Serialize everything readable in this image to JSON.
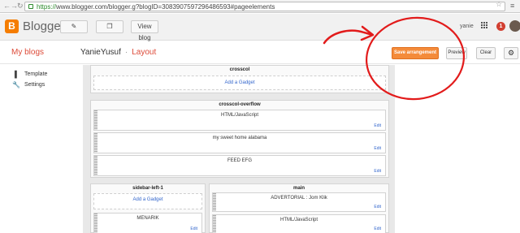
{
  "browser": {
    "url_scheme": "https://",
    "url_rest": "www.blogger.com/blogger.g?blogID=3083907597296486593#pageelements"
  },
  "topbar": {
    "logo_letter": "B",
    "logo_text": "Blogger",
    "view_blog_label": "View blog",
    "user_name": "yanie",
    "notification_count": "1"
  },
  "header": {
    "my_blogs": "My blogs",
    "blog_name": "YanieYusuf",
    "separator": "·",
    "section": "Layout",
    "save_label": "Save arrangement",
    "preview_label": "Preview",
    "clear_label": "Clear"
  },
  "sidebar": {
    "items": [
      {
        "label": "Template",
        "icon": "template-icon"
      },
      {
        "label": "Settings",
        "icon": "settings-wrench-icon"
      }
    ]
  },
  "layout": {
    "add_gadget_label": "Add a Gadget",
    "edit_label": "Edit",
    "crosscol": {
      "title": "crosscol"
    },
    "crosscol_overflow": {
      "title": "crosscol-overflow",
      "widgets": [
        "HTML/JavaScript",
        "my sweet home alabama",
        "FEED EFG"
      ]
    },
    "sidebar_left": {
      "title": "sidebar-left-1",
      "widgets": [
        "MENARIK"
      ]
    },
    "main": {
      "title": "main",
      "widgets": [
        "ADVERTORIAL : Jom Klik",
        "HTML/JavaScript"
      ]
    }
  },
  "colors": {
    "accent": "#dd4b39",
    "save_button": "#f48b3a",
    "annotation": "#e21b1b",
    "link": "#3366cc"
  }
}
